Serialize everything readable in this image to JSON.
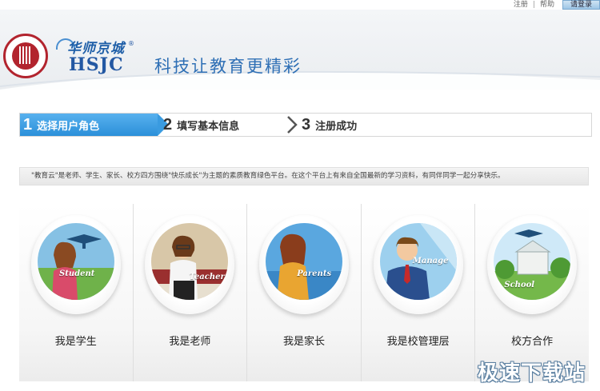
{
  "top_links": {
    "register": "注册",
    "help": "帮助",
    "login": "请登录"
  },
  "header": {
    "brand_cn": "华师京城",
    "brand_en": "HSJC",
    "registered_mark": "®",
    "slogan": "科技让教育更精彩"
  },
  "steps": [
    {
      "num": "1",
      "label": "选择用户角色",
      "active": true
    },
    {
      "num": "2",
      "label": "填写基本信息",
      "active": false
    },
    {
      "num": "3",
      "label": "注册成功",
      "active": false
    }
  ],
  "intro_text": "\"教育云\"是老师、学生、家长、校方四方围绕\"快乐成长\"为主题的素质教育绿色平台。在这个平台上有来自全国最新的学习资料，有同伴同学一起分享快乐。",
  "roles": [
    {
      "tag": "Student",
      "label": "我是学生"
    },
    {
      "tag": "Teacher",
      "label": "我是老师"
    },
    {
      "tag": "Parents",
      "label": "我是家长"
    },
    {
      "tag": "Manage",
      "label": "我是校管理层"
    },
    {
      "tag": "School",
      "label": "校方合作"
    }
  ],
  "watermark": "极速下载站",
  "colors": {
    "accent_blue": "#2b8fd9",
    "emblem_red": "#b2242e",
    "brand_blue": "#2358a3"
  }
}
